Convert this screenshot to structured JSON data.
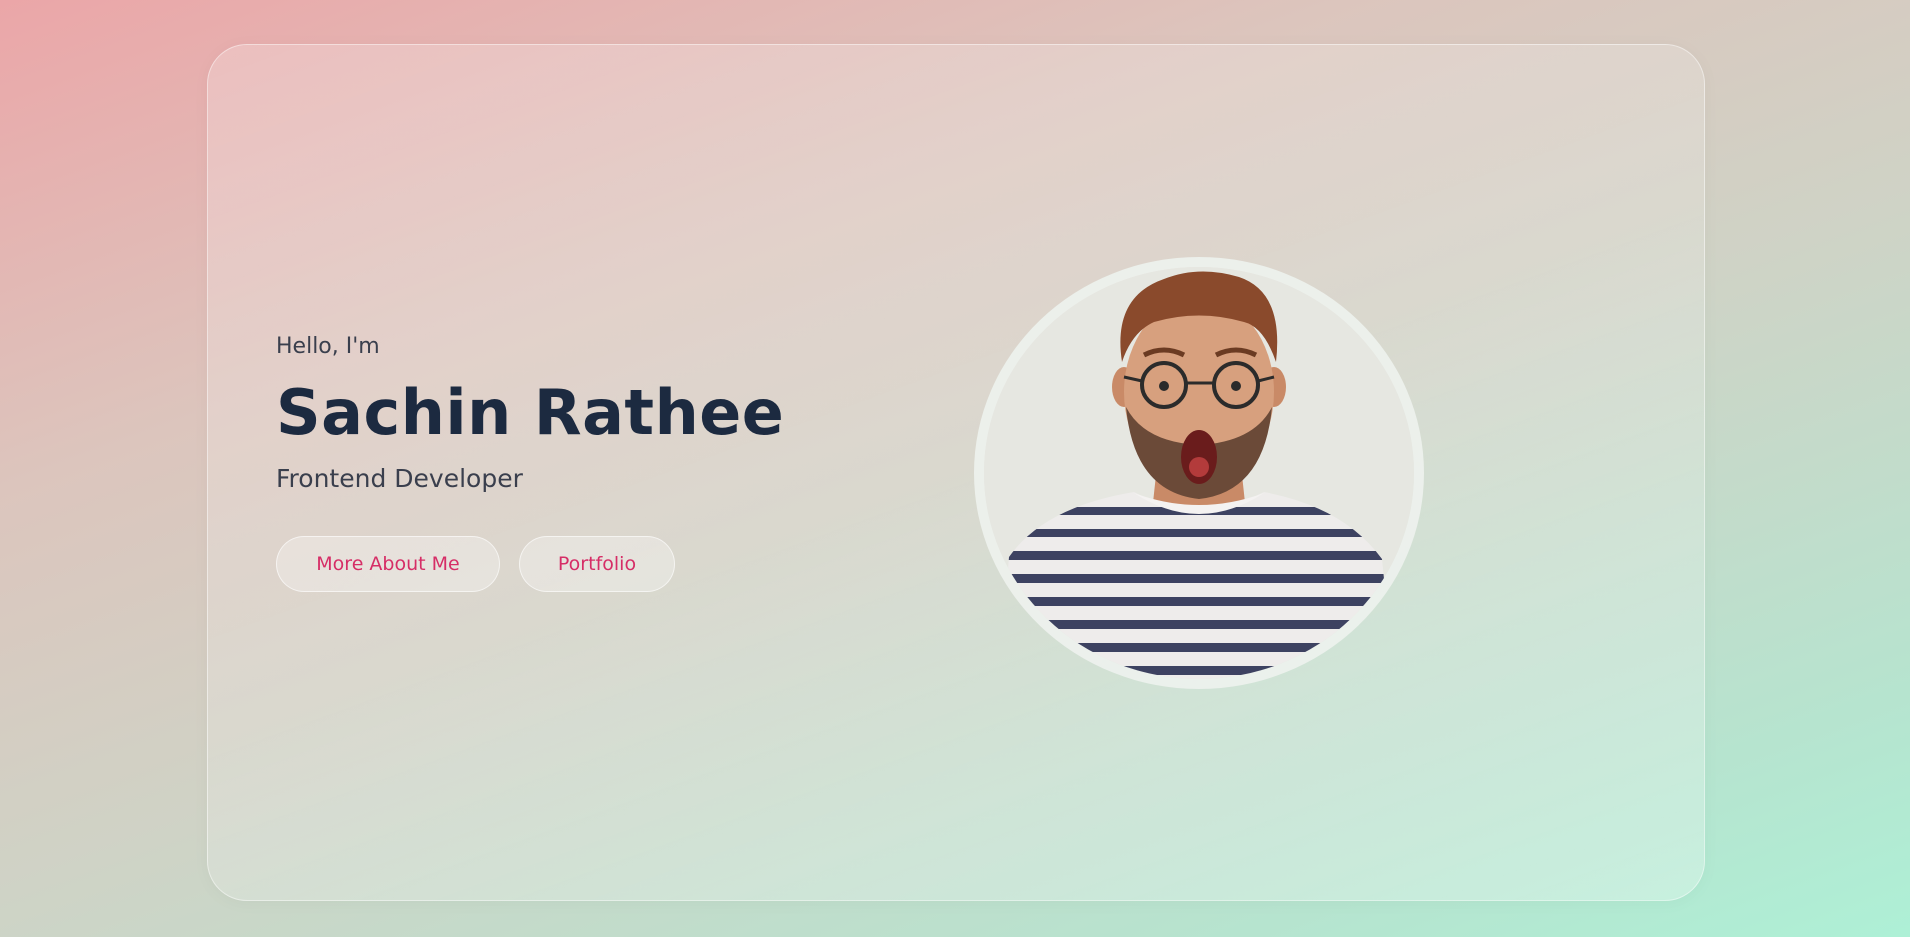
{
  "hero": {
    "greeting": "Hello, I'm",
    "name": "Sachin Rathee",
    "role": "Frontend Developer",
    "buttons": {
      "about_label": "More About Me",
      "portfolio_label": "Portfolio"
    }
  },
  "avatar": {
    "icon": "profile-photo"
  },
  "colors": {
    "accent": "#d62d66",
    "heading": "#1c2a40",
    "text": "#3a3f4d"
  }
}
